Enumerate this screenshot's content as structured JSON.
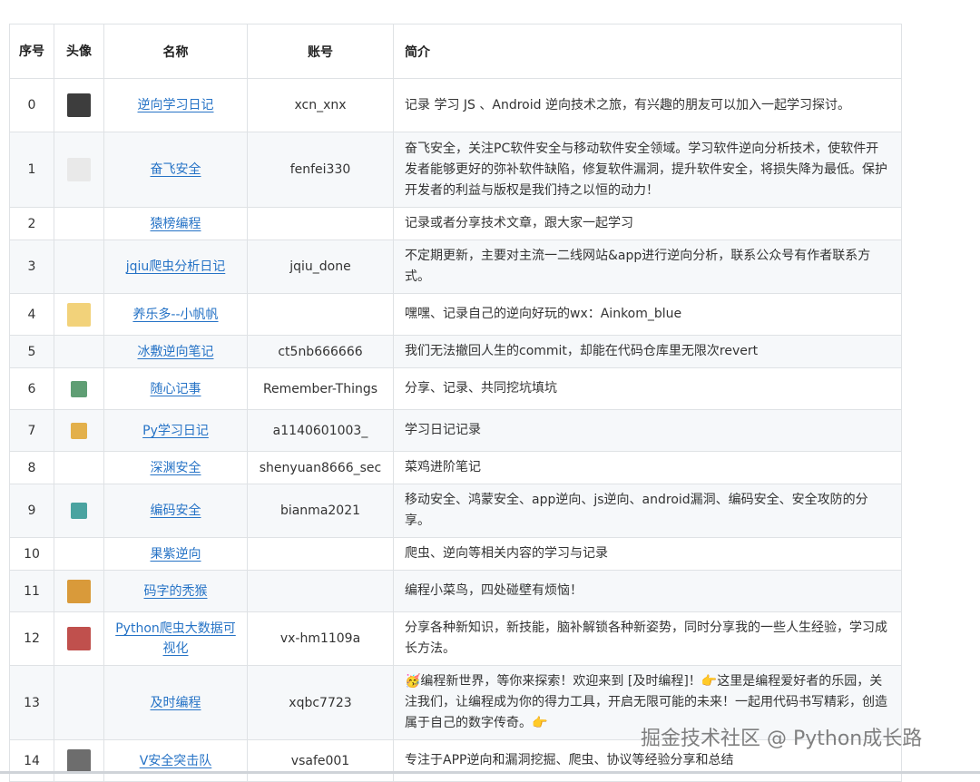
{
  "table": {
    "headers": {
      "index": "序号",
      "avatar": "头像",
      "name": "名称",
      "account": "账号",
      "intro": "简介"
    },
    "rows": [
      {
        "index": "0",
        "name": "逆向学习日记",
        "account": "xcn_xnx",
        "intro": "记录 学习 JS 、Android 逆向技术之旅，有兴趣的朋友可以加入一起学习探讨。",
        "avatar_color": "#3d3d3d",
        "avatar_icon": "dark-portrait-avatar"
      },
      {
        "index": "1",
        "name": "奋飞安全",
        "account": "fenfei330",
        "intro": "奋飞安全，关注PC软件安全与移动软件安全领域。学习软件逆向分析技术，使软件开发者能够更好的弥补软件缺陷，修复软件漏洞，提升软件安全，将损失降为最低。保护开发者的利益与版权是我们持之以恒的动力！",
        "avatar_color": "#e9e9e9",
        "avatar_icon": "sketch-face-avatar"
      },
      {
        "index": "2",
        "name": "猿榜编程",
        "account": "",
        "intro": "记录或者分享技术文章，跟大家一起学习",
        "avatar_color": "",
        "avatar_icon": ""
      },
      {
        "index": "3",
        "name": "jqiu爬虫分析日记",
        "account": "jqiu_done",
        "intro": "不定期更新，主要对主流一二线网站&app进行逆向分析，联系公众号有作者联系方式。",
        "avatar_color": "",
        "avatar_icon": ""
      },
      {
        "index": "4",
        "name": "养乐多--小帆帆",
        "account": "",
        "intro": "嘿嘿、记录自己的逆向好玩的wx：Ainkom_blue",
        "avatar_color": "#f2d27a",
        "avatar_icon": "cartoon-yellow-avatar"
      },
      {
        "index": "5",
        "name": "冰敷逆向笔记",
        "account": "ct5nb666666",
        "intro": "我们无法撤回人生的commit，却能在代码仓库里无限次revert",
        "avatar_color": "",
        "avatar_icon": ""
      },
      {
        "index": "6",
        "name": "随心记事",
        "account": "Remember-Things",
        "intro": "分享、记录、共同挖坑填坑",
        "avatar_color": "#5f9e74",
        "avatar_icon": "green-leaf-avatar"
      },
      {
        "index": "7",
        "name": "Py学习日记",
        "account": "a1140601003_",
        "intro": "学习日记记录",
        "avatar_color": "#e3b04b",
        "avatar_icon": "orange-badge-avatar"
      },
      {
        "index": "8",
        "name": "深渊安全",
        "account": "shenyuan8666_sec",
        "intro": "菜鸡进阶笔记",
        "avatar_color": "",
        "avatar_icon": ""
      },
      {
        "index": "9",
        "name": "编码安全",
        "account": "bianma2021",
        "intro": "移动安全、鸿蒙安全、app逆向、js逆向、android漏洞、编码安全、安全攻防的分享。",
        "avatar_color": "#4aa3a0",
        "avatar_icon": "shield-logo-avatar"
      },
      {
        "index": "10",
        "name": "果紫逆向",
        "account": "",
        "intro": "爬虫、逆向等相关内容的学习与记录",
        "avatar_color": "",
        "avatar_icon": ""
      },
      {
        "index": "11",
        "name": "码字的秃猴",
        "account": "",
        "intro": "编程小菜鸟，四处碰壁有烦恼！",
        "avatar_color": "#d99a3a",
        "avatar_icon": "monkey-avatar"
      },
      {
        "index": "12",
        "name": "Python爬虫大数据可视化",
        "account": "vx-hm1109a",
        "intro": "分享各种新知识，新技能，脑补解锁各种新姿势，同时分享我的一些人生经验，学习成长方法。",
        "avatar_color": "#c0504d",
        "avatar_icon": "cartoon-face-avatar"
      },
      {
        "index": "13",
        "name": "及时编程",
        "account": "xqbc7723",
        "intro": "🥳编程新世界，等你来探索！欢迎来到 [及时编程]！👉这里是编程爱好者的乐园，关注我们，让编程成为你的得力工具，开启无限可能的未来！一起用代码书写精彩，创造属于自己的数字传奇。👉",
        "avatar_color": "",
        "avatar_icon": ""
      },
      {
        "index": "14",
        "name": "V安全突击队",
        "account": "vsafe001",
        "intro": "专注于APP逆向和漏洞挖掘、爬虫、协议等经验分享和总结",
        "avatar_color": "#6d6d6d",
        "avatar_icon": "gray-logo-avatar"
      }
    ]
  },
  "watermark": "掘金技术社区 @ Python成长路"
}
